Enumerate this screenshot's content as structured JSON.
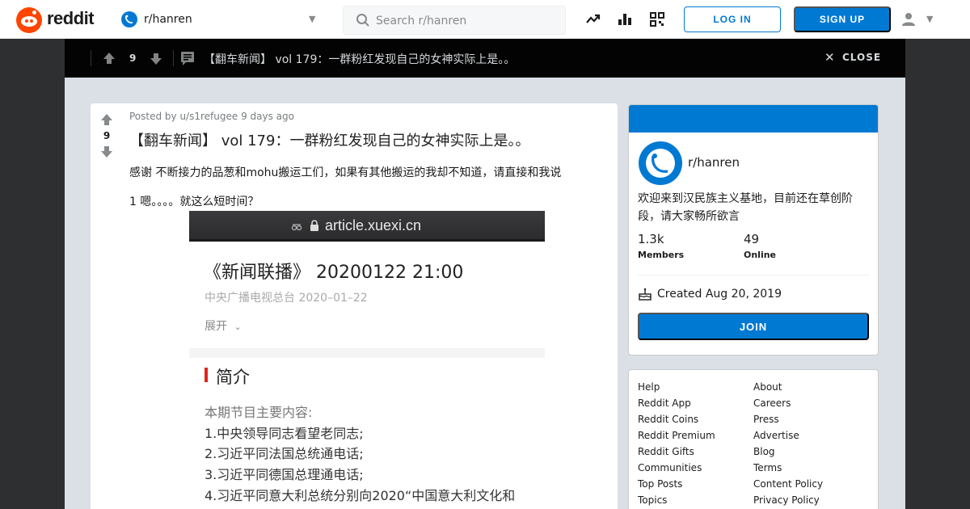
{
  "header": {
    "wordmark": "reddit",
    "subreddit": "r/hanren",
    "search_placeholder": "Search r/hanren",
    "login_label": "LOG IN",
    "signup_label": "SIGN UP",
    "icons": [
      "trending-icon",
      "stats-icon",
      "qr-code-icon",
      "user-icon"
    ]
  },
  "postbar": {
    "vote_count": "9",
    "title": "【翻车新闻】 vol 179：一群粉红发现自己的女神实际上是。。",
    "close_label": "CLOSE"
  },
  "post": {
    "vote_count": "9",
    "meta": "Posted by u/s1refugee 9 days ago",
    "title": "【翻车新闻】 vol 179：一群粉红发现自己的女神实际上是。。",
    "body_line1": "感谢 不断接力的品葱和mohu搬运工们，如果有其他搬运的我却不知道，请直接和我说",
    "body_line2": "1 嗯。。。。就这么短时间？",
    "image": {
      "url": "article.xuexi.cn",
      "heading": "《新闻联播》 20200122 21:00",
      "source": "中央广播电视总台   2020–01–22",
      "expand": "展开",
      "section": "简介",
      "lines": [
        "本期节目主要内容:",
        "1.中央领导同志看望老同志;",
        "2.习近平同法国总统通电话;",
        "3.习近平同德国总理通电话;",
        "4.习近平同意大利总统分别向2020“中国意大利文化和"
      ]
    }
  },
  "sidebar": {
    "name": "r/hanren",
    "description": "欢迎来到汉民族主义基地，目前还在草创阶段，请大家畅所欲言",
    "members_count": "1.3k",
    "members_label": "Members",
    "online_count": "49",
    "online_label": "Online",
    "created": "Created Aug 20, 2019",
    "join_label": "JOIN"
  },
  "footer_links": {
    "left": [
      "Help",
      "Reddit App",
      "Reddit Coins",
      "Reddit Premium",
      "Reddit Gifts",
      "Communities",
      "Top Posts",
      "Topics"
    ],
    "right": [
      "About",
      "Careers",
      "Press",
      "Advertise",
      "Blog",
      "Terms",
      "Content Policy",
      "Privacy Policy"
    ]
  },
  "colors": {
    "brand": "#ff4500",
    "accent": "#0079d3",
    "overlay": "#dae0e6",
    "postbar": "#030303"
  }
}
